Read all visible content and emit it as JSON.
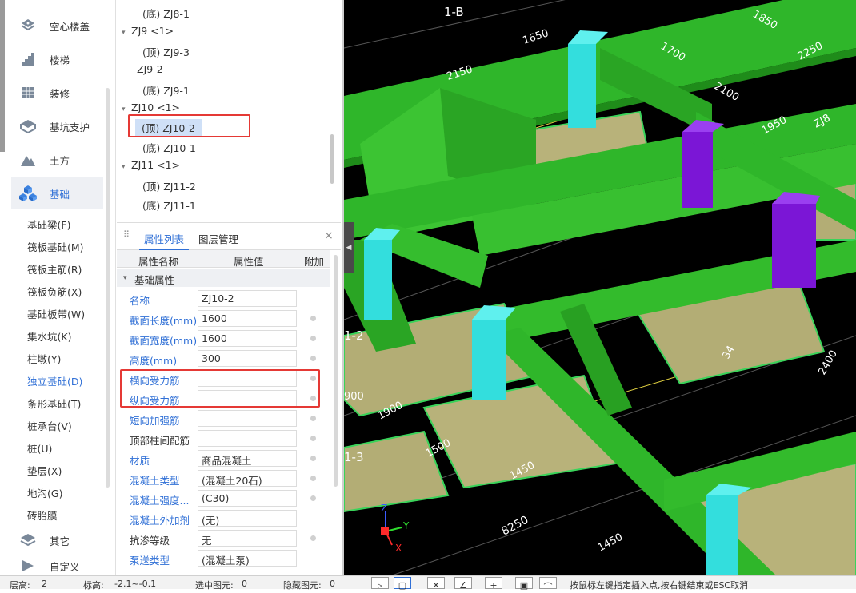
{
  "nav": {
    "categories": [
      {
        "label": "空心楼盖",
        "icon": "hollow-slab-icon"
      },
      {
        "label": "楼梯",
        "icon": "stairs-icon"
      },
      {
        "label": "装修",
        "icon": "decoration-icon"
      },
      {
        "label": "基坑支护",
        "icon": "pit-support-icon"
      },
      {
        "label": "土方",
        "icon": "earthwork-icon"
      },
      {
        "label": "基础",
        "icon": "foundation-icon"
      },
      {
        "label": "其它",
        "icon": "other-icon"
      },
      {
        "label": "自定义",
        "icon": "custom-icon"
      }
    ],
    "foundation_items": [
      "基础梁(F)",
      "筏板基础(M)",
      "筏板主筋(R)",
      "筏板负筋(X)",
      "基础板带(W)",
      "集水坑(K)",
      "柱墩(Y)",
      "独立基础(D)",
      "条形基础(T)",
      "桩承台(V)",
      "桩(U)",
      "垫层(X)",
      "地沟(G)",
      "砖胎膜"
    ],
    "active_item": "独立基础(D)"
  },
  "tree": {
    "nodes": [
      {
        "text": "(底) ZJ8-1",
        "level": 2
      },
      {
        "text": "ZJ9 <1>",
        "level": 0
      },
      {
        "text": "(顶) ZJ9-3",
        "level": 2
      },
      {
        "text": "ZJ9-2",
        "level": 1
      },
      {
        "text": "(底) ZJ9-1",
        "level": 2
      },
      {
        "text": "ZJ10 <1>",
        "level": 0
      },
      {
        "text": "(顶) ZJ10-2",
        "level": 2,
        "selected": true
      },
      {
        "text": "(底) ZJ10-1",
        "level": 2
      },
      {
        "text": "ZJ11 <1>",
        "level": 0
      },
      {
        "text": "(顶) ZJ11-2",
        "level": 2
      },
      {
        "text": "(底) ZJ11-1",
        "level": 2
      }
    ]
  },
  "props": {
    "tabs": [
      "属性列表",
      "图层管理"
    ],
    "close": "×",
    "headers": {
      "name": "属性名称",
      "value": "属性值",
      "extra": "附加"
    },
    "group": "基础属性",
    "rows": [
      {
        "name": "名称",
        "value": "ZJ10-2",
        "blue": true,
        "dot": false
      },
      {
        "name": "截面长度(mm)",
        "value": "1600",
        "blue": true,
        "dot": true
      },
      {
        "name": "截面宽度(mm)",
        "value": "1600",
        "blue": true,
        "dot": true
      },
      {
        "name": "高度(mm)",
        "value": "300",
        "blue": true,
        "dot": true
      },
      {
        "name": "横向受力筋",
        "value": "",
        "blue": true,
        "dot": true
      },
      {
        "name": "纵向受力筋",
        "value": "",
        "blue": true,
        "dot": true
      },
      {
        "name": "短向加强筋",
        "value": "",
        "blue": true,
        "dot": true
      },
      {
        "name": "顶部柱间配筋",
        "value": "",
        "blue": false,
        "dot": true
      },
      {
        "name": "材质",
        "value": "商品混凝土",
        "blue": true,
        "dot": true
      },
      {
        "name": "混凝土类型",
        "value": "(混凝土20石)",
        "blue": true,
        "dot": true
      },
      {
        "name": "混凝土强度...",
        "value": "(C30)",
        "blue": true,
        "dot": true
      },
      {
        "name": "混凝土外加剂",
        "value": "(无)",
        "blue": true,
        "dot": false
      },
      {
        "name": "抗渗等级",
        "value": "无",
        "blue": false,
        "dot": true
      },
      {
        "name": "泵送类型",
        "value": "(混凝土泵)",
        "blue": true,
        "dot": false
      }
    ]
  },
  "viewport": {
    "axis_labels": [
      "1-B",
      "1-2",
      "1-3"
    ],
    "dims": [
      "1650",
      "1850",
      "2150",
      "1700",
      "2250",
      "2100",
      "1950",
      "1900",
      "1500",
      "1450",
      "8250",
      "1450",
      "34",
      "2400",
      "900",
      "ZJ8"
    ],
    "axes": {
      "x": "X",
      "y": "Y",
      "z": "Z"
    }
  },
  "status": {
    "floor_label": "层高:",
    "floor_value": "2",
    "elev_label": "标高:",
    "elev_value": "-2.1~-0.1",
    "selected_label": "选中图元:",
    "selected_value": "0",
    "hidden_label": "隐藏图元:",
    "hidden_value": "0",
    "hint": "按鼠标左键指定插入点,按右键结束或ESC取消"
  }
}
